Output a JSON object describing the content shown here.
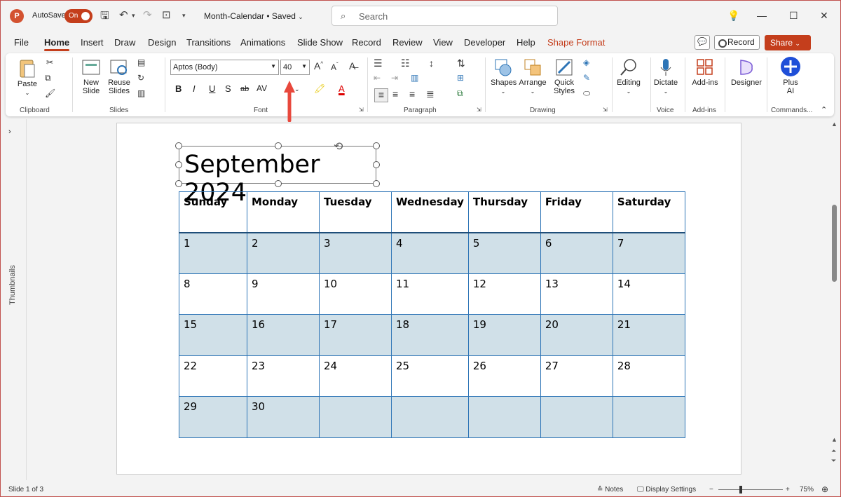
{
  "titlebar": {
    "app_logo": "P",
    "autosave_label": "AutoSave",
    "autosave_state": "On",
    "document_title": "Month-Calendar • Saved",
    "search_placeholder": "Search"
  },
  "tabs": [
    "File",
    "Home",
    "Insert",
    "Draw",
    "Design",
    "Transitions",
    "Animations",
    "Slide Show",
    "Record",
    "Review",
    "View",
    "Developer",
    "Help",
    "Shape Format"
  ],
  "active_tab": "Home",
  "header_buttons": {
    "record": "Record",
    "share": "Share"
  },
  "ribbon": {
    "clipboard": {
      "paste": "Paste",
      "group": "Clipboard"
    },
    "slides": {
      "new_slide_1": "New",
      "new_slide_2": "Slide",
      "reuse_1": "Reuse",
      "reuse_2": "Slides",
      "group": "Slides"
    },
    "font": {
      "font_name": "Aptos (Body)",
      "font_size": "40",
      "group": "Font",
      "bold": "B",
      "italic": "I",
      "underline": "U",
      "shadow": "S",
      "strike": "ab",
      "spacing": "AV",
      "grow": "A",
      "shrink": "A"
    },
    "paragraph": {
      "group": "Paragraph"
    },
    "drawing": {
      "shapes": "Shapes",
      "arrange": "Arrange",
      "quick_1": "Quick",
      "quick_2": "Styles",
      "group": "Drawing"
    },
    "editing": {
      "label": "Editing"
    },
    "voice": {
      "dictate": "Dictate",
      "group": "Voice"
    },
    "addins": {
      "label": "Add-ins",
      "group": "Add-ins"
    },
    "designer": {
      "label": "Designer"
    },
    "plusai": {
      "label_1": "Plus",
      "label_2": "AI",
      "group": "Commands..."
    }
  },
  "thumbnails_label": "Thumbnails",
  "slide": {
    "title": "September 2024",
    "weekdays": [
      "Sunday",
      "Monday",
      "Tuesday",
      "Wednesday",
      "Thursday",
      "Friday",
      "Saturday"
    ],
    "weeks": [
      [
        "1",
        "2",
        "3",
        "4",
        "5",
        "6",
        "7"
      ],
      [
        "8",
        "9",
        "10",
        "11",
        "12",
        "13",
        "14"
      ],
      [
        "15",
        "16",
        "17",
        "18",
        "19",
        "20",
        "21"
      ],
      [
        "22",
        "23",
        "24",
        "25",
        "26",
        "27",
        "28"
      ],
      [
        "29",
        "30",
        "",
        "",
        "",
        "",
        ""
      ]
    ]
  },
  "status": {
    "slide_info": "Slide 1 of 3",
    "notes": "Notes",
    "display_settings": "Display Settings",
    "zoom": "75%"
  },
  "colors": {
    "accent": "#c43e1c",
    "table_border": "#2e75b6",
    "shaded_row": "#d0e0e8",
    "arrow": "#e8483c"
  }
}
